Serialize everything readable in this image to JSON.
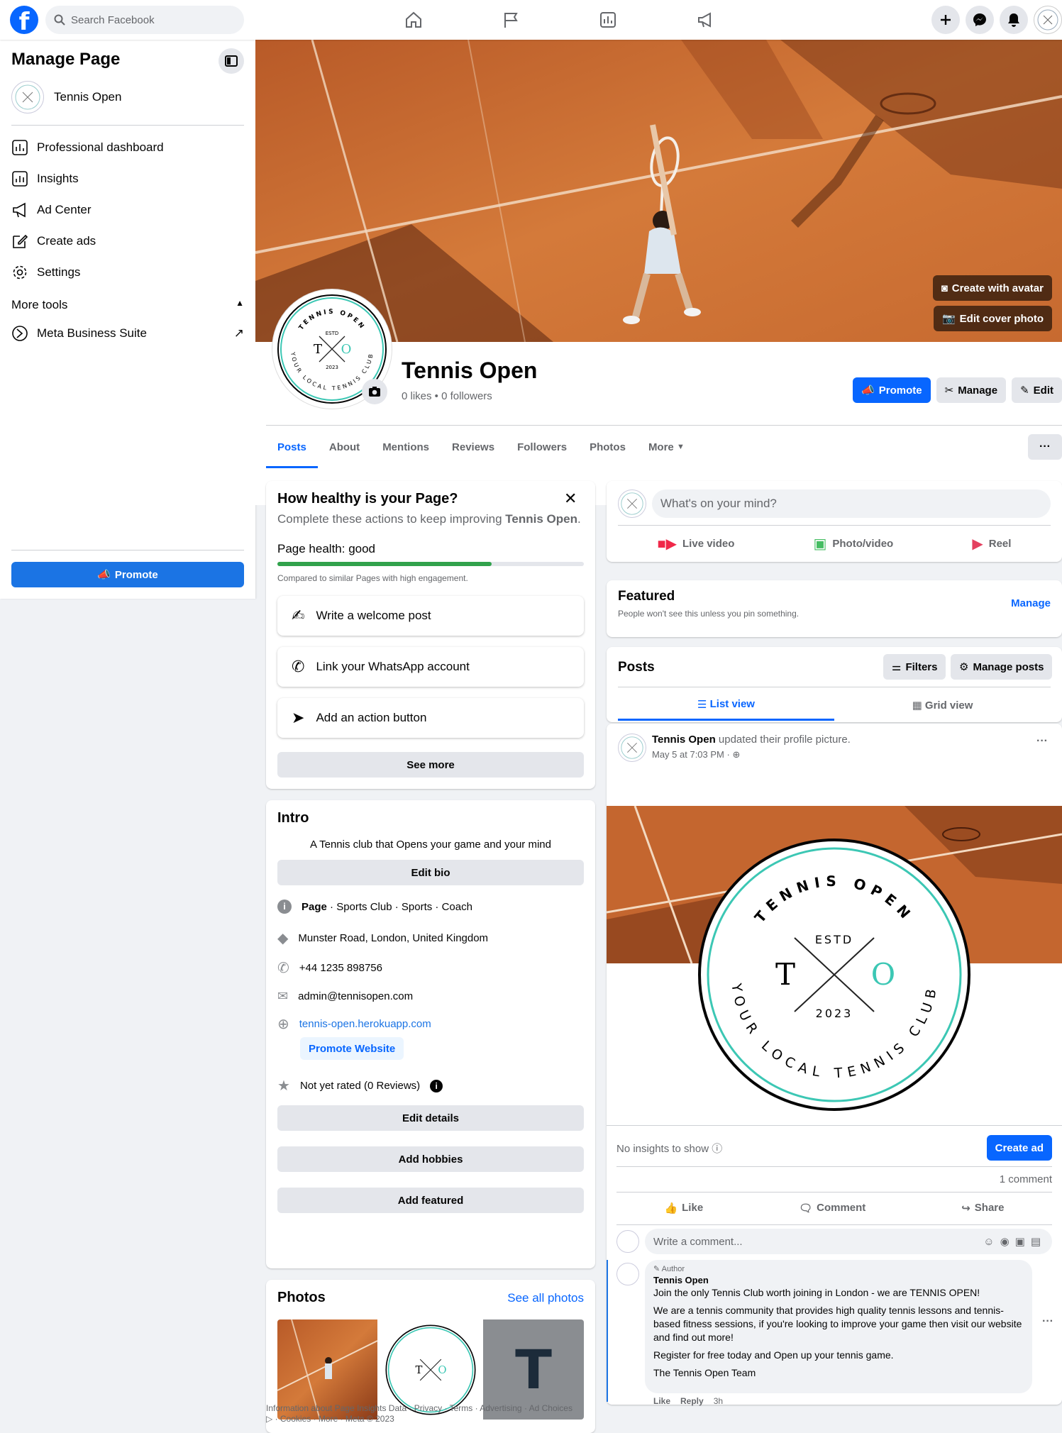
{
  "topbar": {
    "search_placeholder": "Search Facebook"
  },
  "sidebar": {
    "title": "Manage Page",
    "page_name": "Tennis Open",
    "items": [
      {
        "label": "Professional dashboard",
        "icon": "dashboard-icon"
      },
      {
        "label": "Insights",
        "icon": "insights-icon"
      },
      {
        "label": "Ad Center",
        "icon": "megaphone-icon"
      },
      {
        "label": "Create ads",
        "icon": "pencil-icon"
      },
      {
        "label": "Settings",
        "icon": "gear-icon"
      }
    ],
    "more_tools": "More tools",
    "mbs": "Meta Business Suite",
    "promote": "Promote"
  },
  "cover": {
    "create_avatar": "Create with avatar",
    "edit_cover": "Edit cover photo"
  },
  "profile": {
    "name": "Tennis Open",
    "stats": "0 likes • 0 followers",
    "promote": "Promote",
    "manage": "Manage",
    "edit": "Edit"
  },
  "logo": {
    "top": "TENNIS OPEN",
    "bottom": "YOUR LOCAL TENNIS CLUB",
    "estd": "ESTD",
    "year": "2023",
    "left": "T",
    "right": "O"
  },
  "tabs": [
    "Posts",
    "About",
    "Mentions",
    "Reviews",
    "Followers",
    "Photos",
    "More"
  ],
  "health": {
    "title": "How healthy is your Page?",
    "subtitle_pre": "Complete these actions to keep improving ",
    "subtitle_page": "Tennis Open",
    "subtitle_post": ".",
    "status": "Page health: good",
    "level": 0.7,
    "compared": "Compared to similar Pages with high engagement.",
    "actions": [
      "Write a welcome post",
      "Link your WhatsApp account",
      "Add an action button"
    ],
    "see_more": "See more"
  },
  "intro": {
    "title": "Intro",
    "bio": "A Tennis club that Opens your game and your mind",
    "edit_bio": "Edit bio",
    "category_bold": "Page",
    "category": " · Sports Club · Sports · Coach",
    "address": "Munster Road, London, United Kingdom",
    "phone": "+44 1235 898756",
    "email": "admin@tennisopen.com",
    "website": "tennis-open.herokuapp.com",
    "promote_website": "Promote Website",
    "rating": "Not yet rated (0 Reviews)",
    "edit_details": "Edit details",
    "add_hobbies": "Add hobbies",
    "add_featured": "Add featured"
  },
  "photos": {
    "title": "Photos",
    "see_all": "See all photos",
    "third_letter": "T"
  },
  "footer": {
    "line1": "Information about Page Insights Data · Privacy · Terms · Advertising · Ad Choices",
    "line2": "▷ · Cookies · More · Meta © 2023"
  },
  "composer": {
    "placeholder": "What's on your mind?",
    "live": "Live video",
    "photo": "Photo/video",
    "reel": "Reel"
  },
  "featured": {
    "title": "Featured",
    "desc": "People won't see this unless you pin something.",
    "manage": "Manage"
  },
  "posts": {
    "title": "Posts",
    "filters": "Filters",
    "manage_posts": "Manage posts",
    "list_view": "List view",
    "grid_view": "Grid view"
  },
  "post": {
    "author": "Tennis Open",
    "action": " updated their profile picture.",
    "time": "May 5 at 7:03 PM · ",
    "no_insights": "No insights to show",
    "create_ad": "Create ad",
    "comments": "1 comment",
    "like": "Like",
    "comment": "Comment",
    "share": "Share",
    "comment_placeholder": "Write a comment..."
  },
  "comment": {
    "badge": "Author",
    "name": "Tennis Open",
    "p1": "Join the only Tennis Club worth joining in London - we are TENNIS OPEN!",
    "p2": "We are a tennis community that provides high quality tennis lessons and tennis-based fitness sessions, if you're looking to improve your game then visit our website and find out more!",
    "p3": "Register for free today and Open up your tennis game.",
    "p4": "The Tennis Open Team",
    "like": "Like",
    "reply": "Reply",
    "time": "3h"
  },
  "colors": {
    "accent": "#0866ff",
    "clay": "#c0652b",
    "teal": "#3cc7b4"
  }
}
